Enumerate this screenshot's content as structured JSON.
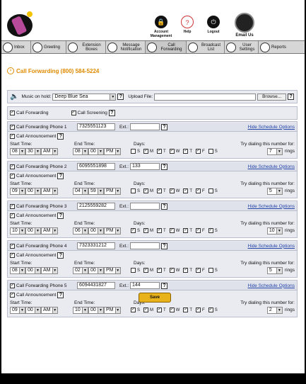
{
  "header": {
    "links": [
      {
        "label": "Account Management",
        "icon": "lock-icon",
        "glyph": "🔒"
      },
      {
        "label": "Help",
        "icon": "help-icon",
        "glyph": "?"
      },
      {
        "label": "Logout",
        "icon": "logout-icon",
        "glyph": "⏻"
      }
    ],
    "email_us": "Email Us"
  },
  "nav": [
    {
      "label": "Inbox"
    },
    {
      "label": "Greeting"
    },
    {
      "label": "Extension Boxes"
    },
    {
      "label": "Message Notification"
    },
    {
      "label": "Call Forwarding"
    },
    {
      "label": "Broadcast List"
    },
    {
      "label": "User Settings"
    },
    {
      "label": "Reports"
    }
  ],
  "page_title": "Call Forwarding (800) 584-5224",
  "music": {
    "label": "Music on hold:",
    "value": "Deep Blue Sea",
    "upload_label": "Upload File:",
    "browse": "Browse..."
  },
  "options": {
    "call_forwarding": "Call Forwarding",
    "call_screening": "Call Screening"
  },
  "labels": {
    "ext": "Ext.:",
    "hide": "Hide Schedule Options",
    "call_announcement": "Call Announcement",
    "start_time": "Start Time:",
    "end_time": "End Time:",
    "days": "Days:",
    "try_dialing": "Try dialing this number for:",
    "rings": "rings"
  },
  "day_letters": [
    "S",
    "M",
    "T",
    "W",
    "T",
    "F",
    "S"
  ],
  "phones": [
    {
      "label": "Call Forwarding Phone 1",
      "number": "7325551123",
      "ext": "",
      "start": [
        "08",
        "30",
        "AM"
      ],
      "end": [
        "08",
        "00",
        "PM"
      ],
      "days": [
        false,
        true,
        true,
        true,
        true,
        true,
        false
      ],
      "rings": "7"
    },
    {
      "label": "Call Forwarding Phone 2",
      "number": "6095551898",
      "ext": "133",
      "start": [
        "09",
        "00",
        "AM"
      ],
      "end": [
        "04",
        "59",
        "PM"
      ],
      "days": [
        false,
        true,
        true,
        true,
        true,
        true,
        false
      ],
      "rings": "5"
    },
    {
      "label": "Call Forwarding Phone 3",
      "number": "2125559282",
      "ext": "",
      "start": [
        "10",
        "00",
        "AM"
      ],
      "end": [
        "06",
        "00",
        "PM"
      ],
      "days": [
        true,
        true,
        true,
        true,
        true,
        true,
        true
      ],
      "rings": "10"
    },
    {
      "label": "Call Forwarding Phone 4",
      "number": "7323331212",
      "ext": "",
      "start": [
        "08",
        "00",
        "AM"
      ],
      "end": [
        "02",
        "00",
        "PM"
      ],
      "days": [
        false,
        true,
        true,
        true,
        true,
        true,
        false
      ],
      "rings": "5"
    },
    {
      "label": "Call Forwarding Phone 5",
      "number": "6094431827",
      "ext": "144",
      "start": [
        "09",
        "00",
        "AM"
      ],
      "end": [
        "10",
        "00",
        "PM"
      ],
      "days": [
        true,
        true,
        true,
        true,
        true,
        true,
        true
      ],
      "rings": "2"
    }
  ],
  "save_label": "Save"
}
